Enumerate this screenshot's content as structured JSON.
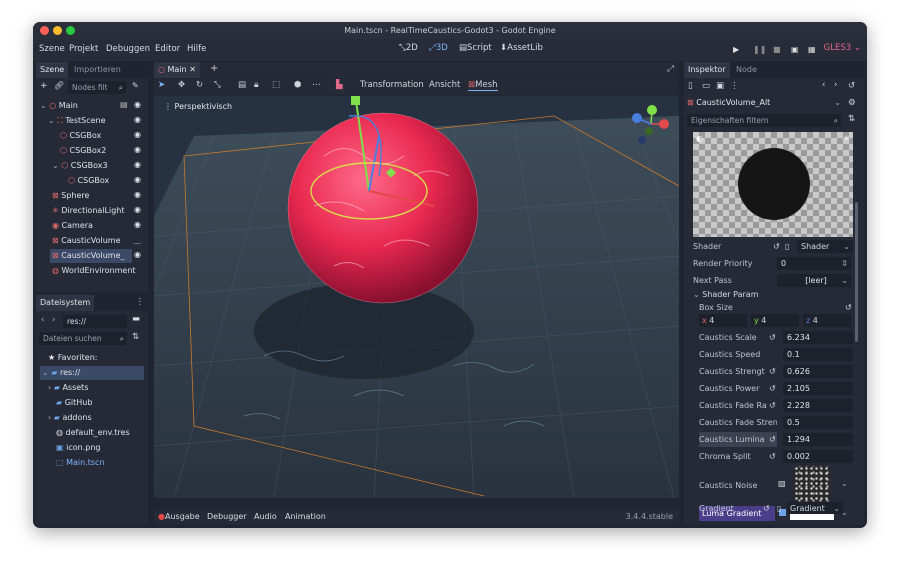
{
  "window": {
    "title": "Main.tscn - RealTimeCaustics-Godot3 - Godot Engine",
    "colors": {
      "close": "#fe5f57",
      "minimize": "#febc2e",
      "maximize": "#28c840",
      "accent": "#7fb4ff",
      "selection": "#3a4a66",
      "lumaHighlight": "#4a3e8a"
    }
  },
  "menu": {
    "scene": "Szene",
    "project": "Projekt",
    "debug": "Debuggen",
    "editor": "Editor",
    "help": "Hilfe"
  },
  "workspaces": {
    "w2d": "2D",
    "w3d": "3D",
    "script": "Script",
    "assetlib": "AssetLib"
  },
  "renderer": "GLES3",
  "scene_dock": {
    "tab_scene": "Szene",
    "tab_import": "Importieren",
    "filter_placeholder": "Nodes filt",
    "nodes": [
      {
        "label": "Main",
        "icon": "node-icon"
      },
      {
        "label": "TestScene",
        "icon": "spatial-icon"
      },
      {
        "label": "CSGBox",
        "icon": "csg-icon"
      },
      {
        "label": "CSGBox2",
        "icon": "csg-icon"
      },
      {
        "label": "CSGBox3",
        "icon": "csg-icon"
      },
      {
        "label": "CSGBox",
        "icon": "csg-icon"
      },
      {
        "label": "Sphere",
        "icon": "mesh-icon"
      },
      {
        "label": "DirectionalLight",
        "icon": "light-icon"
      },
      {
        "label": "Camera",
        "icon": "camera-icon"
      },
      {
        "label": "CausticVolume",
        "icon": "mesh-icon"
      },
      {
        "label": "CausticVolume_",
        "icon": "mesh-icon"
      },
      {
        "label": "WorldEnvironment",
        "icon": "world-icon"
      }
    ]
  },
  "fs_dock": {
    "title": "Dateisystem",
    "path": "res://",
    "search_placeholder": "Dateien suchen",
    "favorites": "Favoriten:",
    "items": [
      {
        "label": "res://"
      },
      {
        "label": "Assets"
      },
      {
        "label": "GitHub"
      },
      {
        "label": "addons"
      },
      {
        "label": "default_env.tres"
      },
      {
        "label": "icon.png"
      },
      {
        "label": "Main.tscn"
      }
    ]
  },
  "viewport": {
    "tab": "Main",
    "mode_label": "Perspektivisch",
    "transform": "Transformation",
    "view": "Ansicht",
    "mesh": "Mesh"
  },
  "bottom": {
    "output": "Ausgabe",
    "debugger": "Debugger",
    "audio": "Audio",
    "animation": "Animation",
    "version": "3.4.4.stable"
  },
  "inspector": {
    "tab_inspector": "Inspektor",
    "tab_node": "Node",
    "object": "CausticVolume_Alt",
    "filter_placeholder": "Eigenschaften filtern",
    "shader_label": "Shader",
    "shader_value": "Shader",
    "render_priority_label": "Render Priority",
    "render_priority_value": "0",
    "next_pass_label": "Next Pass",
    "next_pass_value": "[leer]",
    "section": "Shader Param",
    "box_size_label": "Box Size",
    "box": {
      "x": "4",
      "y": "4",
      "z": "4"
    },
    "params": [
      {
        "label": "Caustics Scale",
        "value": "6.234"
      },
      {
        "label": "Caustics Speed",
        "value": "0.1"
      },
      {
        "label": "Caustics Strengt",
        "value": "0.626"
      },
      {
        "label": "Caustics Power",
        "value": "2.105"
      },
      {
        "label": "Caustics Fade Ra",
        "value": "2.228"
      },
      {
        "label": "Caustics Fade Stren",
        "value": "0.5"
      },
      {
        "label": "Caustics Lumina",
        "value": "1.294"
      },
      {
        "label": "Chroma Split",
        "value": "0.002"
      }
    ],
    "noise_label": "Caustics Noise",
    "luma_label": "Luma Gradient",
    "gradient_label": "Gradient",
    "gradient_value": "Gradient"
  }
}
